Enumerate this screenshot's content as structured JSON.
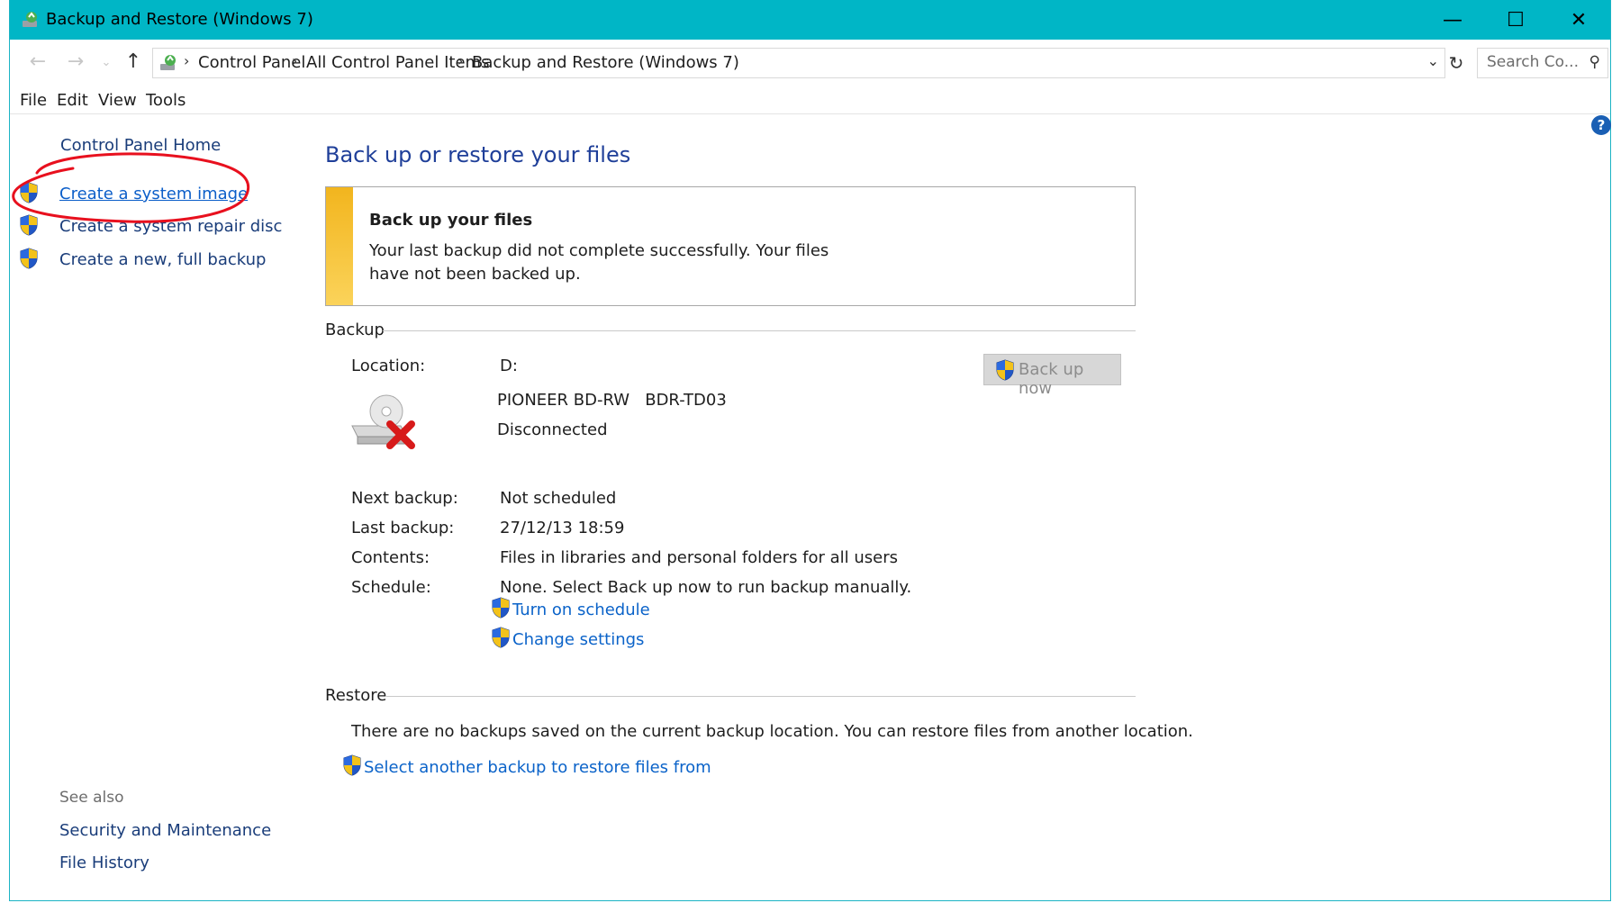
{
  "window": {
    "title": "Backup and Restore (Windows 7)",
    "controls": {
      "minimize": "—",
      "maximize": "☐",
      "close": "✕"
    }
  },
  "address": {
    "crumbs": [
      "Control Panel",
      "All Control Panel Items",
      "Backup and Restore (Windows 7)"
    ],
    "search_placeholder": "Search Co..."
  },
  "menu": [
    "File",
    "Edit",
    "View",
    "Tools"
  ],
  "sidebar": {
    "home": "Control Panel Home",
    "tasks": [
      "Create a system image",
      "Create a system repair disc",
      "Create a new, full backup"
    ],
    "see_also_label": "See also",
    "see_also": [
      "Security and Maintenance",
      "File History"
    ]
  },
  "main": {
    "title": "Back up or restore your files",
    "notice": {
      "heading": "Back up your files",
      "message": "Your last backup did not complete successfully. Your files have not been backed up."
    },
    "backup": {
      "section_label": "Backup",
      "location_label": "Location:",
      "location_value": "D:",
      "device_name": "PIONEER BD-RW   BDR-TD03",
      "device_status": "Disconnected",
      "backup_now_button": "Back up now",
      "next_backup_label": "Next backup:",
      "next_backup_value": "Not scheduled",
      "last_backup_label": "Last backup:",
      "last_backup_value": "27/12/13 18:59",
      "contents_label": "Contents:",
      "contents_value": "Files in libraries and personal folders for all users",
      "schedule_label": "Schedule:",
      "schedule_value": "None. Select Back up now to run backup manually.",
      "turn_on_schedule_link": "Turn on schedule",
      "change_settings_link": "Change settings"
    },
    "restore": {
      "section_label": "Restore",
      "message": "There are no backups saved on the current backup location. You can restore files from another location.",
      "select_link": "Select another backup to restore files from"
    }
  },
  "colors": {
    "titlebar": "#00b6c6",
    "link": "#0b63c9",
    "heading": "#1f3f99",
    "annotation": "#e8101e",
    "notice_bar": "#f2b51e"
  },
  "icons": [
    "app-icon",
    "back-arrow-icon",
    "forward-arrow-icon",
    "up-arrow-icon",
    "refresh-icon",
    "search-icon",
    "help-icon",
    "uac-shield-icon",
    "disconnected-drive-icon"
  ]
}
